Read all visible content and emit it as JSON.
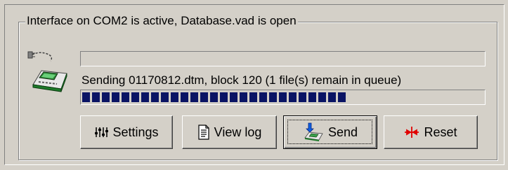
{
  "group": {
    "title": "Interface on COM2 is active, Database.vad is open"
  },
  "transfer": {
    "status": "Sending 01170812.dtm, block 120 (1 file(s) remain in queue)",
    "file_progress": 0,
    "block_progress": 0.66
  },
  "buttons": {
    "settings": "Settings",
    "view_log": "View log",
    "send": "Send",
    "reset": "Reset"
  },
  "icons": {
    "device": "device-icon",
    "settings": "sliders-icon",
    "view_log": "document-icon",
    "send": "send-icon",
    "reset": "reset-icon"
  },
  "colors": {
    "background": "#d4d0c8",
    "progress": "#0a1464",
    "reset_icon": "#e00000"
  }
}
